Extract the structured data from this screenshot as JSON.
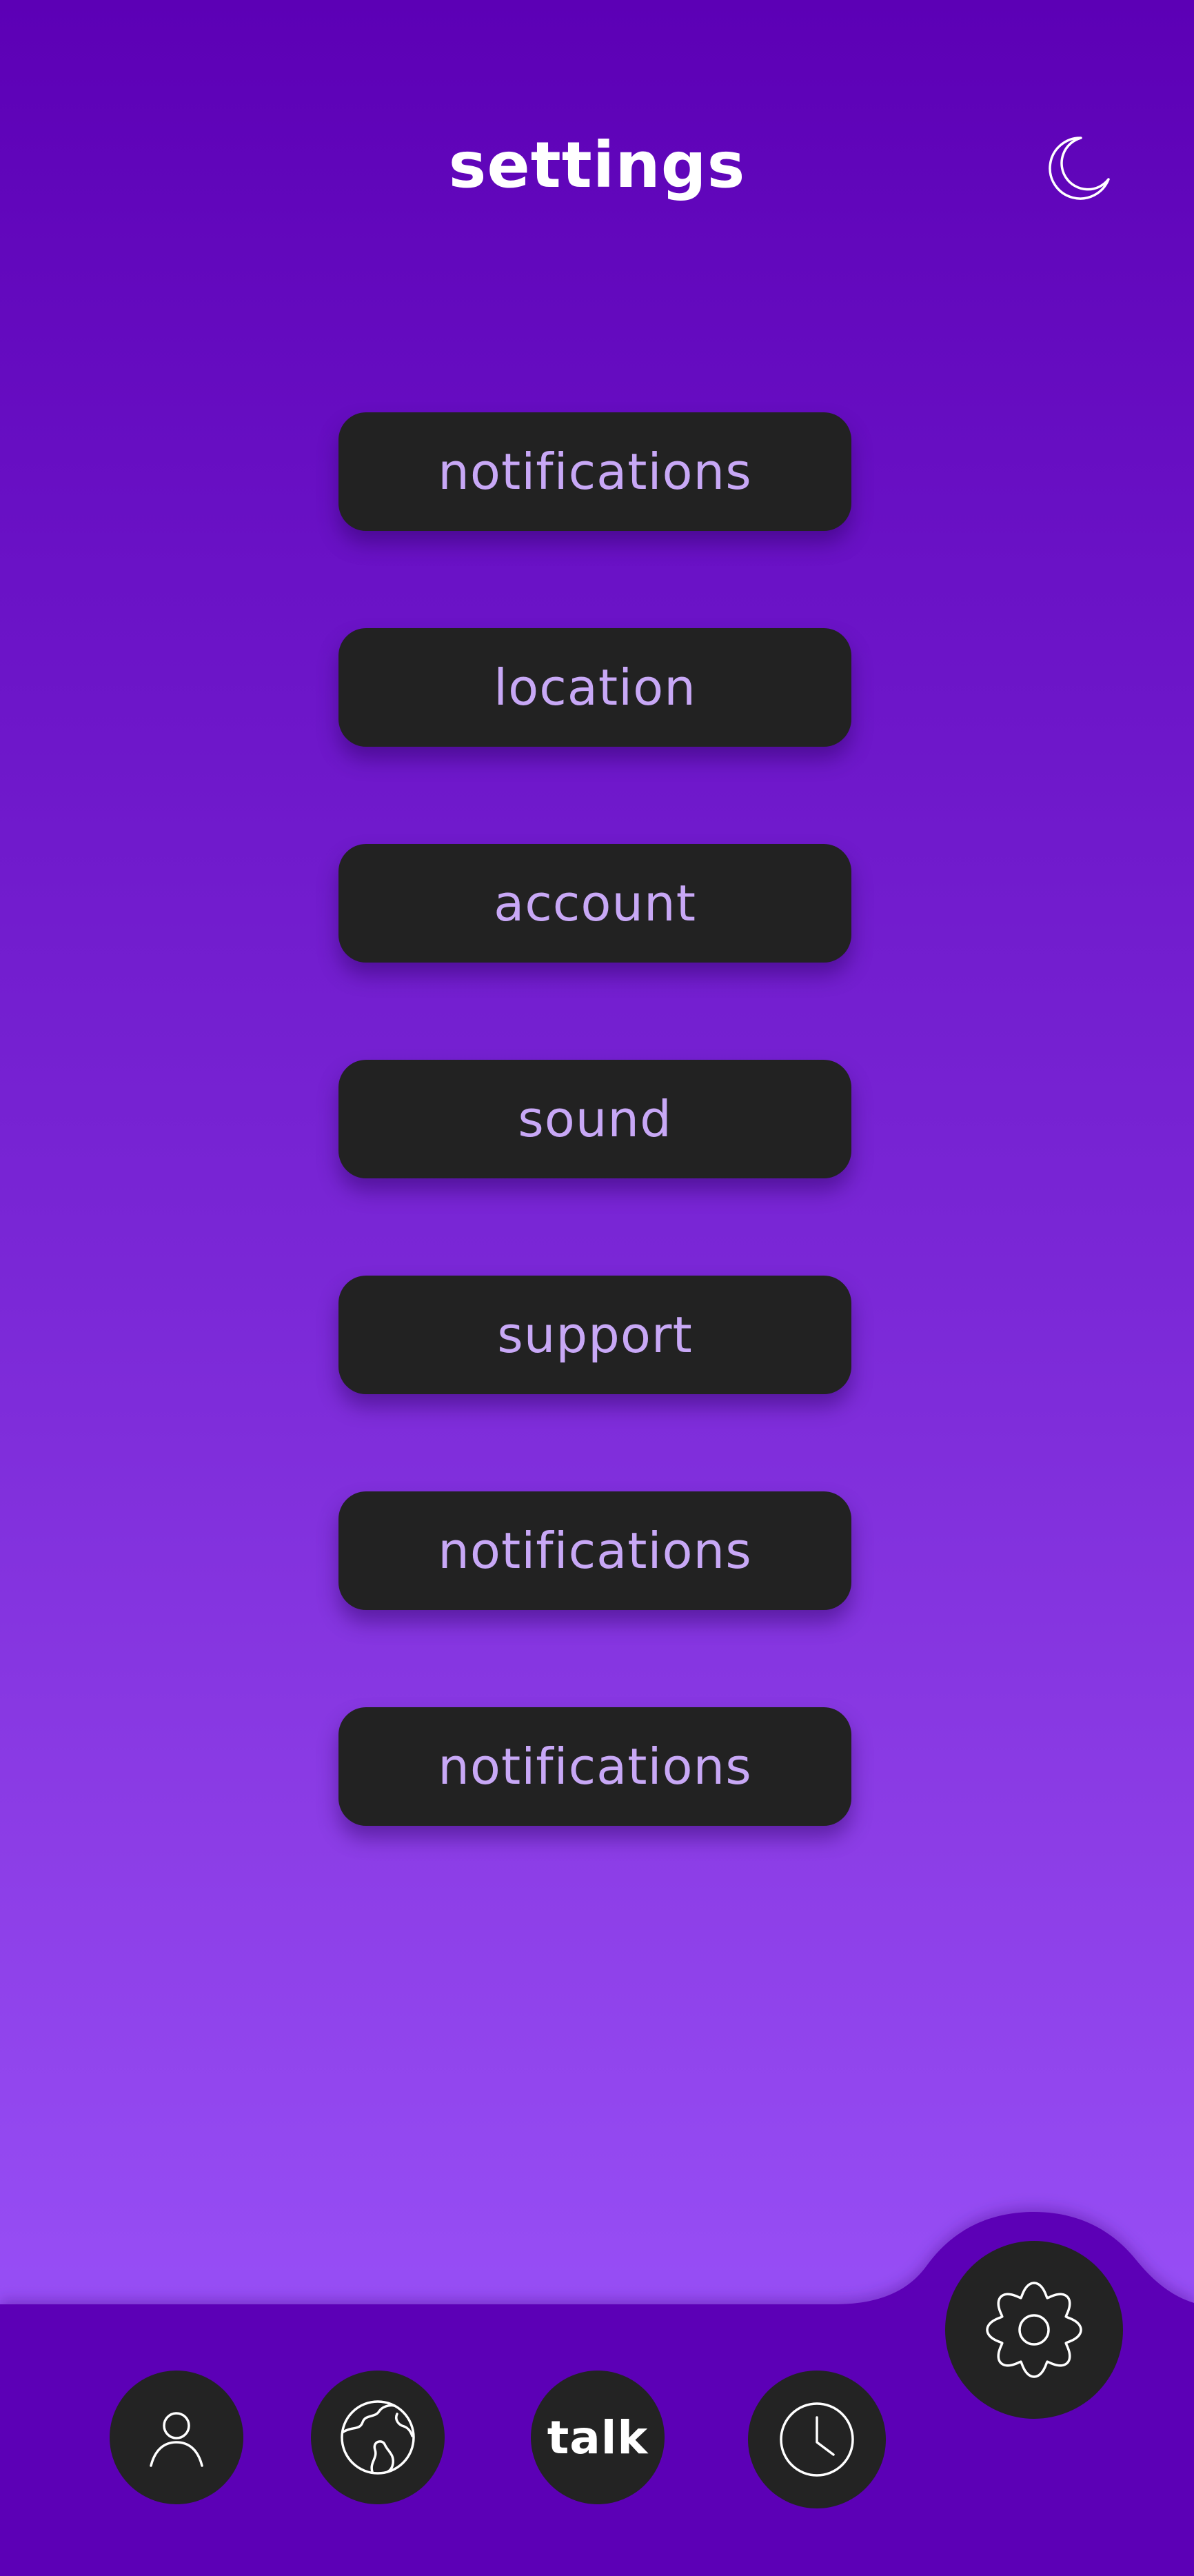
{
  "header": {
    "title": "settings",
    "theme_toggle_icon": "moon-icon"
  },
  "menu": {
    "items": [
      {
        "label": "notifications"
      },
      {
        "label": "location"
      },
      {
        "label": "account"
      },
      {
        "label": "sound"
      },
      {
        "label": "support"
      },
      {
        "label": "notifications"
      },
      {
        "label": "notifications"
      }
    ]
  },
  "bottom_nav": {
    "items": [
      {
        "icon": "user-icon"
      },
      {
        "icon": "globe-icon"
      },
      {
        "label": "talk"
      },
      {
        "icon": "clock-icon"
      }
    ],
    "active": {
      "icon": "gear-icon"
    }
  },
  "colors": {
    "background_top": "#5c00b5",
    "background_bottom": "#974ef5",
    "nav_bar": "#5b00b6",
    "button_bg": "#222222",
    "button_text": "#c8a8f6",
    "title_text": "#ffffff"
  }
}
